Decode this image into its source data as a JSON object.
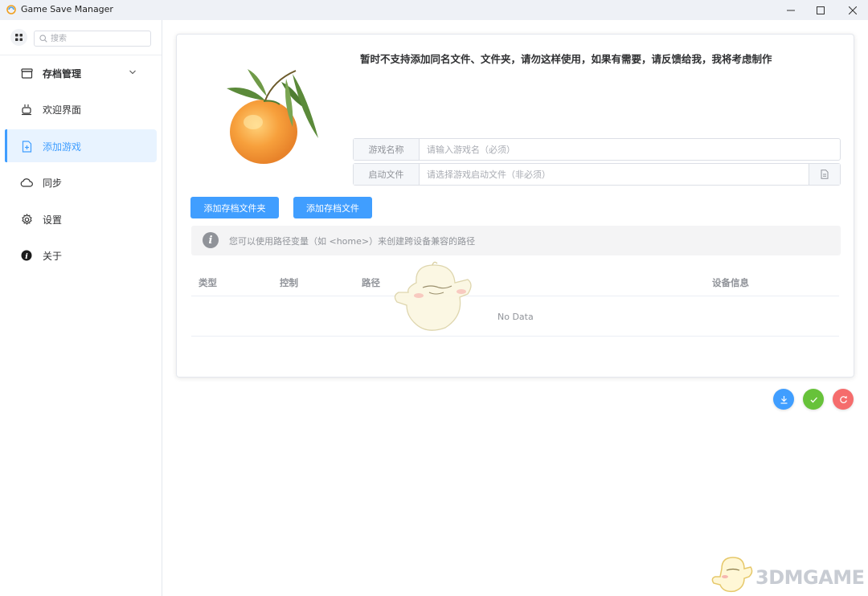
{
  "window": {
    "title": "Game Save Manager"
  },
  "sidebar": {
    "search_placeholder": "搜索",
    "items": [
      {
        "label": "存档管理",
        "icon": "archive-icon"
      },
      {
        "label": "欢迎界面",
        "icon": "cup-icon"
      },
      {
        "label": "添加游戏",
        "icon": "document-add-icon"
      },
      {
        "label": "同步",
        "icon": "cloud-icon"
      },
      {
        "label": "设置",
        "icon": "gear-icon"
      },
      {
        "label": "关于",
        "icon": "info-icon"
      }
    ],
    "active_index": 2
  },
  "main": {
    "notice": "暂时不支持添加同名文件、文件夹，请勿这样使用，如果有需要，请反馈给我，我将考虑制作",
    "form": {
      "game_name_label": "游戏名称",
      "game_name_placeholder": "请输入游戏名（必须）",
      "launch_file_label": "启动文件",
      "launch_file_placeholder": "请选择游戏启动文件（非必须）"
    },
    "buttons": {
      "add_folder": "添加存档文件夹",
      "add_file": "添加存档文件"
    },
    "tip": "您可以使用路径变量（如 <home>）来创建跨设备兼容的路径",
    "table": {
      "headers": [
        "类型",
        "控制",
        "路径",
        "设备信息"
      ],
      "rows": [],
      "empty_text": "No Data"
    }
  },
  "actions": [
    {
      "name": "download",
      "color": "#409eff"
    },
    {
      "name": "confirm",
      "color": "#67c23a"
    },
    {
      "name": "reset",
      "color": "#f56c6c"
    }
  ],
  "watermark": "3DMGAME"
}
